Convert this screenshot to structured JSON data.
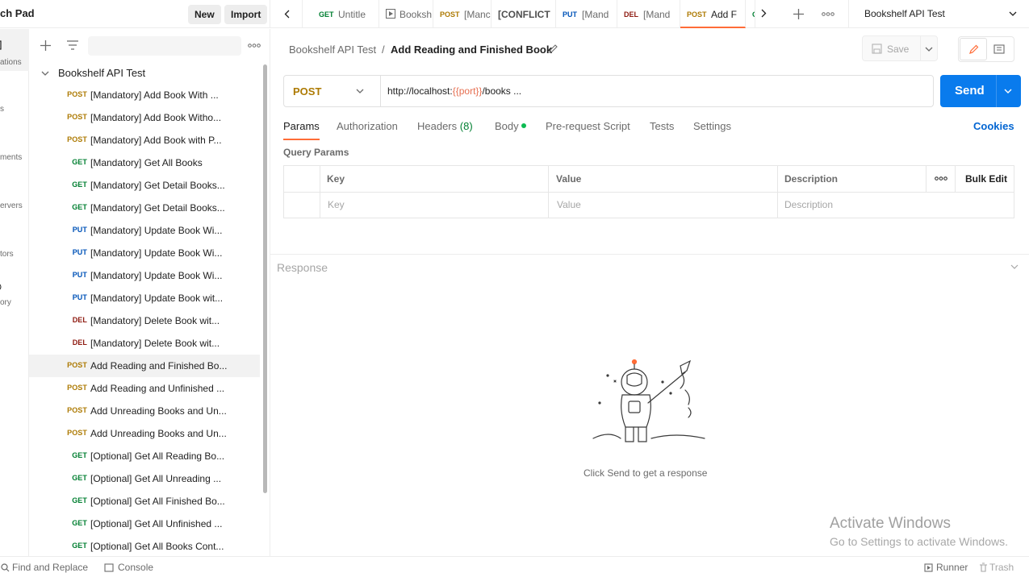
{
  "header": {
    "workspace_title": "ch Pad",
    "new_label": "New",
    "import_label": "Import"
  },
  "rail": {
    "items": [
      {
        "label": "ations",
        "icon": "collections-icon",
        "active": true
      },
      {
        "label": "s",
        "icon": "api-icon"
      },
      {
        "label": "ments",
        "icon": "environments-icon"
      },
      {
        "label": "ervers",
        "icon": "mock-servers-icon"
      },
      {
        "label": "tors",
        "icon": "monitors-icon"
      },
      {
        "label": "ory",
        "icon": "history-icon"
      }
    ]
  },
  "sidebar": {
    "collection_name": "Bookshelf API Test",
    "requests": [
      {
        "method": "POST",
        "name": "[Mandatory] Add Book With ..."
      },
      {
        "method": "POST",
        "name": "[Mandatory] Add Book Witho..."
      },
      {
        "method": "POST",
        "name": "[Mandatory] Add Book with P..."
      },
      {
        "method": "GET",
        "name": "[Mandatory] Get All Books"
      },
      {
        "method": "GET",
        "name": "[Mandatory] Get Detail Books..."
      },
      {
        "method": "GET",
        "name": "[Mandatory] Get Detail Books..."
      },
      {
        "method": "PUT",
        "name": "[Mandatory] Update Book Wi..."
      },
      {
        "method": "PUT",
        "name": "[Mandatory] Update Book Wi..."
      },
      {
        "method": "PUT",
        "name": "[Mandatory] Update Book Wi..."
      },
      {
        "method": "PUT",
        "name": "[Mandatory] Update Book wit..."
      },
      {
        "method": "DEL",
        "name": "[Mandatory] Delete Book wit..."
      },
      {
        "method": "DEL",
        "name": "[Mandatory] Delete Book wit..."
      },
      {
        "method": "POST",
        "name": "Add Reading and Finished Bo...",
        "active": true
      },
      {
        "method": "POST",
        "name": "Add Reading and Unfinished ..."
      },
      {
        "method": "POST",
        "name": "Add Unreading Books and Un..."
      },
      {
        "method": "POST",
        "name": "Add Unreading Books and Un..."
      },
      {
        "method": "GET",
        "name": "[Optional] Get All Reading Bo..."
      },
      {
        "method": "GET",
        "name": "[Optional] Get All Unreading ..."
      },
      {
        "method": "GET",
        "name": "[Optional] Get All Finished Bo..."
      },
      {
        "method": "GET",
        "name": "[Optional] Get All Unfinished ..."
      },
      {
        "method": "GET",
        "name": "[Optional] Get All Books Cont..."
      }
    ]
  },
  "tabs": {
    "items": [
      {
        "method": "GET",
        "name": "Untitle"
      },
      {
        "method": "",
        "name": "Booksh",
        "icon": "runner-icon"
      },
      {
        "method": "POST",
        "name": "[Manc"
      },
      {
        "method": "",
        "name": "[CONFLICT"
      },
      {
        "method": "PUT",
        "name": "[Mand"
      },
      {
        "method": "DEL",
        "name": "[Mand"
      },
      {
        "method": "POST",
        "name": "Add F",
        "active": true
      },
      {
        "method": "G",
        "name": ""
      }
    ],
    "workspace_env": "Bookshelf API Test"
  },
  "request": {
    "breadcrumb_collection": "Bookshelf API Test",
    "breadcrumb_separator": "/",
    "breadcrumb_request": "Add Reading and Finished Book",
    "save_label": "Save",
    "method": "POST",
    "url_prefix": "http://localhost:",
    "url_variable": "{{port}}",
    "url_suffix": "/books ...",
    "send_label": "Send",
    "tabs": {
      "params": "Params",
      "authorization": "Authorization",
      "headers": "Headers",
      "headers_count": "(8)",
      "body": "Body",
      "prerequest": "Pre-request Script",
      "tests": "Tests",
      "settings": "Settings",
      "cookies": "Cookies"
    },
    "query_params_title": "Query Params",
    "table": {
      "col_key": "Key",
      "col_value": "Value",
      "col_description": "Description",
      "bulk_edit": "Bulk Edit",
      "placeholder_key": "Key",
      "placeholder_value": "Value",
      "placeholder_description": "Description"
    }
  },
  "response": {
    "title": "Response",
    "empty_message": "Click Send to get a response"
  },
  "watermark": {
    "line1": "Activate Windows",
    "line2": "Go to Settings to activate Windows."
  },
  "statusbar": {
    "find_replace": "Find and Replace",
    "console": "Console",
    "runner": "Runner",
    "trash": "Trash"
  },
  "colors": {
    "post": "#ad7a03",
    "get": "#007f31",
    "put": "#0053b8",
    "del": "#8e1a10",
    "accent": "#ff6c37",
    "send": "#097bed",
    "variable": "#e66e50"
  }
}
